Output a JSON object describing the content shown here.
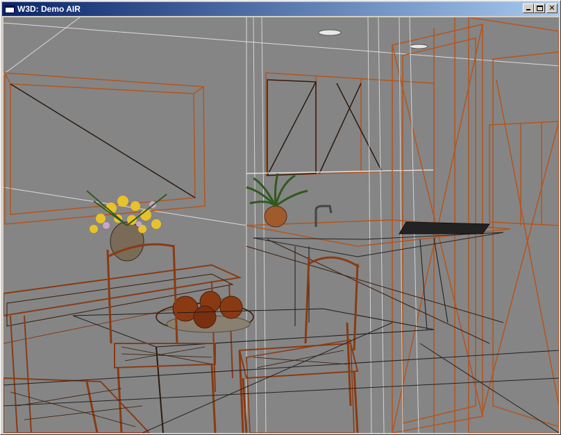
{
  "window": {
    "title": "W3D: Demo AIR",
    "controls": [
      "minimize",
      "maximize",
      "close"
    ]
  },
  "viewport": {
    "render_mode": "wireframe",
    "background": "#858585",
    "wire_colors": {
      "primary": "#b5551c",
      "dark": "#3a1a08",
      "light": "#e0e0e0"
    }
  }
}
